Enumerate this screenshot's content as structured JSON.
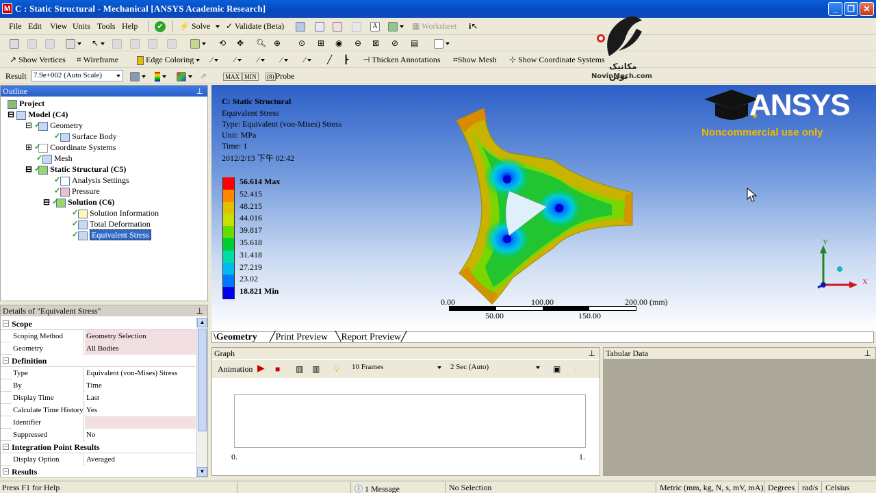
{
  "window": {
    "title": "C : Static Structural - Mechanical [ANSYS Academic Research]",
    "app_icon": "M"
  },
  "menu": [
    "File",
    "Edit",
    "View",
    "Units",
    "Tools",
    "Help"
  ],
  "toolbar1": {
    "solve": "Solve",
    "validate": "Validate (Beta)",
    "worksheet": "Worksheet"
  },
  "toolbar3": {
    "show_vertices": "Show Vertices",
    "wireframe": "Wireframe",
    "edge_coloring": "Edge Coloring",
    "thicken_annotations": "Thicken Annotations",
    "show_mesh": "Show Mesh",
    "show_coordinate_systems": "Show Coordinate Systems"
  },
  "toolbar4": {
    "result_label": "Result",
    "scale_value": "7.9e+002 (Auto Scale)",
    "probe": "Probe"
  },
  "watermark": {
    "fa_text": "مکانیک نوین",
    "site": "NovinMech.com"
  },
  "outline": {
    "title": "Outline",
    "items": [
      {
        "label": "Project"
      },
      {
        "label": "Model (C4)"
      },
      {
        "label": "Geometry"
      },
      {
        "label": "Surface Body"
      },
      {
        "label": "Coordinate Systems"
      },
      {
        "label": "Mesh"
      },
      {
        "label": "Static Structural (C5)"
      },
      {
        "label": "Analysis Settings"
      },
      {
        "label": "Pressure"
      },
      {
        "label": "Solution (C6)"
      },
      {
        "label": "Solution Information"
      },
      {
        "label": "Total Deformation"
      },
      {
        "label": "Equivalent Stress"
      }
    ]
  },
  "details": {
    "title": "Details of \"Equivalent Stress\"",
    "sections": {
      "scope": "Scope",
      "definition": "Definition",
      "integration": "Integration Point Results",
      "results": "Results"
    },
    "rows": {
      "scoping_method": {
        "k": "Scoping Method",
        "v": "Geometry Selection"
      },
      "geometry": {
        "k": "Geometry",
        "v": "All Bodies"
      },
      "type": {
        "k": "Type",
        "v": "Equivalent (von-Mises) Stress"
      },
      "by": {
        "k": "By",
        "v": "Time"
      },
      "display_time": {
        "k": "Display Time",
        "v": "Last"
      },
      "calc_history": {
        "k": "Calculate Time History",
        "v": "Yes"
      },
      "identifier": {
        "k": "Identifier",
        "v": ""
      },
      "suppressed": {
        "k": "Suppressed",
        "v": "No"
      },
      "display_option": {
        "k": "Display Option",
        "v": "Averaged"
      }
    }
  },
  "viewport": {
    "title": "C: Static Structural",
    "result": "Equivalent Stress",
    "type": "Type: Equivalent (von-Mises) Stress",
    "unit": "Unit: MPa",
    "time": "Time: 1",
    "date": "2012/2/13 下午 02:42",
    "legend": [
      {
        "label": "56.614 Max",
        "color": "#ff0000"
      },
      {
        "label": "52.415",
        "color": "#ff8800"
      },
      {
        "label": "48.215",
        "color": "#e0c000"
      },
      {
        "label": "44.016",
        "color": "#c8e000"
      },
      {
        "label": "39.817",
        "color": "#66dd00"
      },
      {
        "label": "35.618",
        "color": "#00cc33"
      },
      {
        "label": "31.418",
        "color": "#00ddaa"
      },
      {
        "label": "27.219",
        "color": "#00bbee"
      },
      {
        "label": "23.02",
        "color": "#0077ff"
      },
      {
        "label": "18.821 Min",
        "color": "#0000ee"
      }
    ],
    "scale_top": [
      "0.00",
      "100.00",
      "200.00 (mm)"
    ],
    "scale_bottom": [
      "50.00",
      "150.00"
    ],
    "ansys_brand": "ANSYS",
    "ansys_note": "Noncommercial use only",
    "axis_y": "Y",
    "axis_x": "X"
  },
  "tabs": [
    "Geometry",
    "Print Preview",
    "Report Preview"
  ],
  "graph": {
    "title": "Graph",
    "animation": "Animation",
    "frames": "10 Frames",
    "duration": "2 Sec (Auto)",
    "x_min": "0.",
    "x_max": "1."
  },
  "tabular": {
    "title": "Tabular Data"
  },
  "status": {
    "help": "Press F1 for Help",
    "messages": "1 Message",
    "selection": "No Selection",
    "units": "Metric (mm, kg, N, s, mV, mA)",
    "angle": "Degrees",
    "rate": "rad/s",
    "temp": "Celsius"
  }
}
